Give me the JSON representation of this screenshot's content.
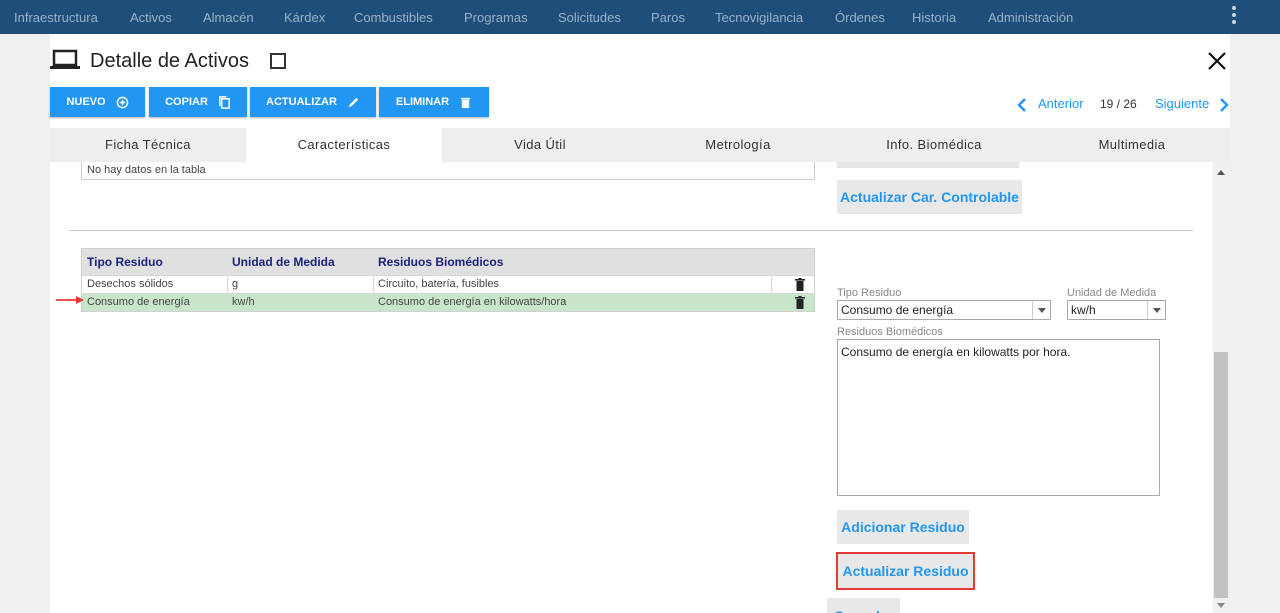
{
  "nav": {
    "items": [
      "Infraestructura",
      "Activos",
      "Almacén",
      "Kárdex",
      "Combustibles",
      "Programas",
      "Solicitudes",
      "Paros",
      "Tecnovigilancia",
      "Órdenes",
      "Historia",
      "Administración"
    ]
  },
  "dialog": {
    "title": "Detalle de Activos",
    "buttons": {
      "nuevo": "NUEVO",
      "copiar": "COPIAR",
      "actualizar": "ACTUALIZAR",
      "eliminar": "ELIMINAR"
    },
    "pager": {
      "prev": "Anterior",
      "count": "19 / 26",
      "next": "Siguiente"
    },
    "tabs": [
      "Ficha Técnica",
      "Características",
      "Vida Útil",
      "Metrología",
      "Info. Biomédica",
      "Multimedia"
    ],
    "active_tab": "Características"
  },
  "upper": {
    "empty_text": "No hay datos en la tabla",
    "update_controlable": "Actualizar Car. Controlable"
  },
  "residuos_table": {
    "headers": [
      "Tipo Residuo",
      "Unidad de Medida",
      "Residuos Biomédicos"
    ],
    "rows": [
      [
        "Desechos sólidos",
        "g",
        "Circuito, batería, fusibles"
      ],
      [
        "Consumo de energía",
        "kw/h",
        "Consumo de energía en kilowatts/hora"
      ]
    ],
    "selected_row": 1
  },
  "form": {
    "tipo_label": "Tipo Residuo",
    "tipo_value": "Consumo de energía",
    "unidad_label": "Unidad de Medida",
    "unidad_value": "kw/h",
    "residuos_label": "Residuos Biomédicos",
    "residuos_value": "Consumo de energía en kilowatts por hora.",
    "add_button": "Adicionar Residuo",
    "update_button": "Actualizar Residuo",
    "cancel_button": "Cancelar"
  },
  "colors": {
    "nav_bg": "#1e4e79",
    "primary": "#2196f3",
    "selected_row": "#c8e6c9",
    "header_text": "#1a237e",
    "highlight": "#e53935"
  }
}
